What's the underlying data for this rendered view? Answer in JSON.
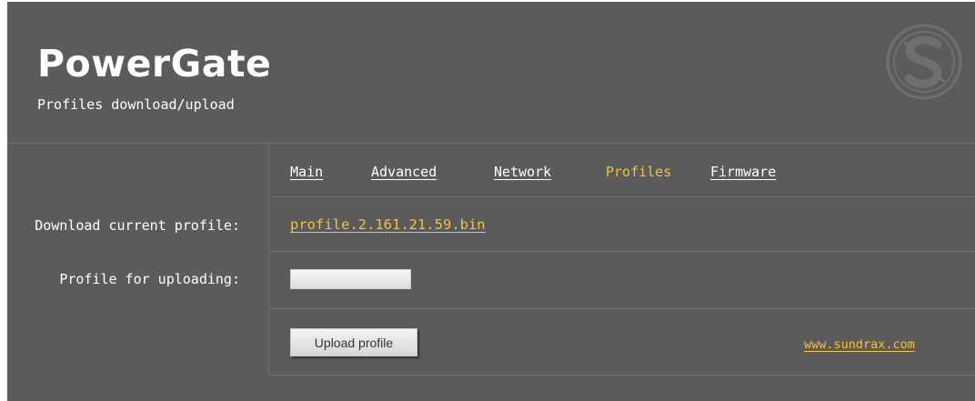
{
  "header": {
    "brand": "PowerGate",
    "subtitle": "Profiles download/upload",
    "logo_icon": "sundrax-s-logo"
  },
  "tabs": [
    {
      "label": "Main",
      "active": false
    },
    {
      "label": "Advanced",
      "active": false
    },
    {
      "label": "Network",
      "active": false
    },
    {
      "label": "Profiles",
      "active": true
    },
    {
      "label": "Firmware",
      "active": false
    }
  ],
  "download": {
    "label": "Download current profile:",
    "file_link": "profile.2.161.21.59.bin"
  },
  "upload": {
    "label": "Profile for uploading:",
    "button_label": "Upload profile"
  },
  "footer": {
    "site_link": "www.sundrax.com"
  },
  "colors": {
    "background": "#5b5b5b",
    "accent": "#f3c13a",
    "text": "#ffffff"
  }
}
